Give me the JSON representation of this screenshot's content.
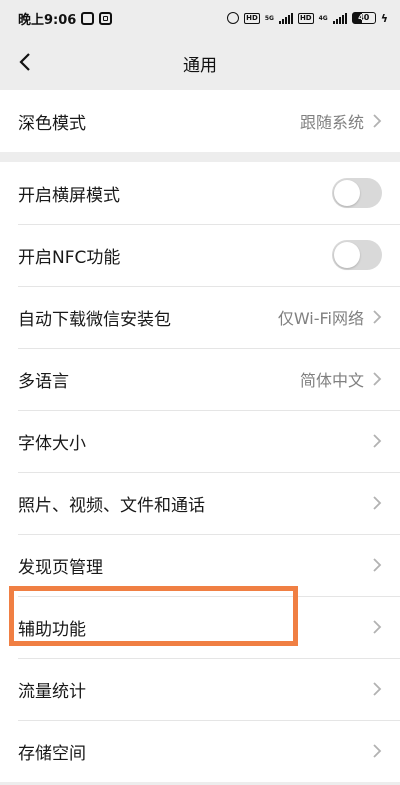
{
  "status_bar": {
    "time": "晚上9:06",
    "battery": "40",
    "network_tag_1": "5G",
    "network_tag_2": "4G",
    "hd_label": "HD"
  },
  "nav": {
    "title": "通用",
    "back_icon": "chevron-left-icon"
  },
  "section1": [
    {
      "label": "深色模式",
      "value": "跟随系统"
    }
  ],
  "section2": [
    {
      "label": "开启横屏模式",
      "toggle": false
    },
    {
      "label": "开启NFC功能",
      "toggle": false
    },
    {
      "label": "自动下载微信安装包",
      "value": "仅Wi-Fi网络"
    },
    {
      "label": "多语言",
      "value": "简体中文"
    },
    {
      "label": "字体大小"
    },
    {
      "label": "照片、视频、文件和通话"
    },
    {
      "label": "发现页管理"
    },
    {
      "label": "辅助功能"
    },
    {
      "label": "流量统计"
    },
    {
      "label": "存储空间"
    }
  ],
  "colors": {
    "background": "#ededed",
    "highlight": "#f07f43",
    "toggle_off": "#d9d9d9"
  }
}
